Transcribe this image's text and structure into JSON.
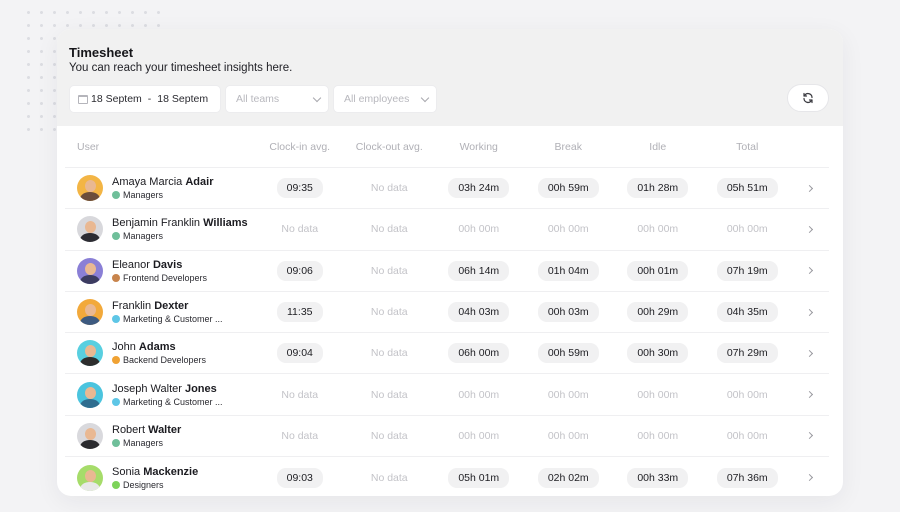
{
  "header": {
    "title": "Timesheet",
    "subtitle": "You can reach your timesheet insights here."
  },
  "filters": {
    "date_from": "18 Septem",
    "date_separator": "-",
    "date_to": "18 Septem",
    "teams_placeholder": "All teams",
    "employees_placeholder": "All employees"
  },
  "icons": {
    "calendar": "calendar-icon",
    "refresh": "refresh-icon",
    "chevron": "chevron-down-icon",
    "row_arrow": "chevron-right-icon"
  },
  "columns": [
    "User",
    "Clock-in avg.",
    "Clock-out avg.",
    "Working",
    "Break",
    "Idle",
    "Total"
  ],
  "colors": {
    "managers": "#6fbf9a",
    "frontend": "#c8844c",
    "marketing": "#5ec6e6",
    "backend": "#f0a233",
    "designers": "#7dd35a"
  },
  "rows": [
    {
      "first": "Amaya Marcia",
      "last": "Adair",
      "team": "Managers",
      "team_color": "#6fbf9a",
      "avatar_bg": "#f3b545",
      "shirt": "#6b4d3b",
      "clock_in": "09:35",
      "clock_out": "No data",
      "working": "03h 24m",
      "break": "00h 59m",
      "idle": "01h 28m",
      "total": "05h 51m"
    },
    {
      "first": "Benjamin Franklin",
      "last": "Williams",
      "team": "Managers",
      "team_color": "#6fbf9a",
      "avatar_bg": "#d8d8dc",
      "shirt": "#2c2c33",
      "clock_in": "No data",
      "clock_out": "No data",
      "working": "00h 00m",
      "break": "00h 00m",
      "idle": "00h 00m",
      "total": "00h 00m"
    },
    {
      "first": "Eleanor",
      "last": "Davis",
      "team": "Frontend Developers",
      "team_color": "#c8844c",
      "avatar_bg": "#8a7fd6",
      "shirt": "#3c3c60",
      "clock_in": "09:06",
      "clock_out": "No data",
      "working": "06h 14m",
      "break": "01h 04m",
      "idle": "00h 01m",
      "total": "07h 19m"
    },
    {
      "first": "Franklin",
      "last": "Dexter",
      "team": "Marketing & Customer ...",
      "team_color": "#5ec6e6",
      "avatar_bg": "#f2a93b",
      "shirt": "#3d5a80",
      "clock_in": "11:35",
      "clock_out": "No data",
      "working": "04h 03m",
      "break": "00h 03m",
      "idle": "00h 29m",
      "total": "04h 35m"
    },
    {
      "first": "John",
      "last": "Adams",
      "team": "Backend Developers",
      "team_color": "#f0a233",
      "avatar_bg": "#58cfe0",
      "shirt": "#2d2d2d",
      "clock_in": "09:04",
      "clock_out": "No data",
      "working": "06h 00m",
      "break": "00h 59m",
      "idle": "00h 30m",
      "total": "07h 29m"
    },
    {
      "first": "Joseph Walter",
      "last": "Jones",
      "team": "Marketing & Customer ...",
      "team_color": "#5ec6e6",
      "avatar_bg": "#4bc4de",
      "shirt": "#2f6d8f",
      "clock_in": "No data",
      "clock_out": "No data",
      "working": "00h 00m",
      "break": "00h 00m",
      "idle": "00h 00m",
      "total": "00h 00m"
    },
    {
      "first": "Robert",
      "last": "Walter",
      "team": "Managers",
      "team_color": "#6fbf9a",
      "avatar_bg": "#d9d9dd",
      "shirt": "#2a2a2e",
      "clock_in": "No data",
      "clock_out": "No data",
      "working": "00h 00m",
      "break": "00h 00m",
      "idle": "00h 00m",
      "total": "00h 00m"
    },
    {
      "first": "Sonia",
      "last": "Mackenzie",
      "team": "Designers",
      "team_color": "#7dd35a",
      "avatar_bg": "#a6dc6a",
      "shirt": "#e8e8e8",
      "clock_in": "09:03",
      "clock_out": "No data",
      "working": "05h 01m",
      "break": "02h 02m",
      "idle": "00h 33m",
      "total": "07h 36m"
    }
  ]
}
